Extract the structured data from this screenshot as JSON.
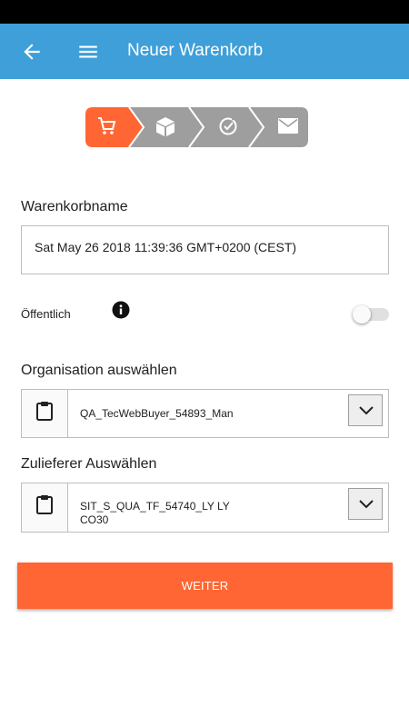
{
  "header": {
    "title": "Neuer Warenkorb",
    "bg_color": "#3e9fd9"
  },
  "stepper": {
    "steps": [
      {
        "icon": "cart-icon",
        "state": "active",
        "color": "#ff6633"
      },
      {
        "icon": "box-icon",
        "state": "inactive",
        "color": "#9e9e9e"
      },
      {
        "icon": "check-circle-icon",
        "state": "inactive",
        "color": "#9e9e9e"
      },
      {
        "icon": "mail-icon",
        "state": "inactive",
        "color": "#9e9e9e"
      }
    ]
  },
  "form": {
    "name_label": "Warenkorbname",
    "name_value": "Sat May 26 2018 11:39:36 GMT+0200 (CEST)",
    "public_label": "Öffentlich",
    "public_toggle_on": false,
    "org_label": "Organisation auswählen",
    "org_value": "QA_TecWebBuyer_54893_Man",
    "supplier_label": "Zulieferer Auswählen",
    "supplier_value_line1": "SIT_S_QUA_TF_54740_LY LY",
    "supplier_value_line2": "CO30"
  },
  "actions": {
    "next_label": "WEITER",
    "next_color": "#ff6633"
  }
}
